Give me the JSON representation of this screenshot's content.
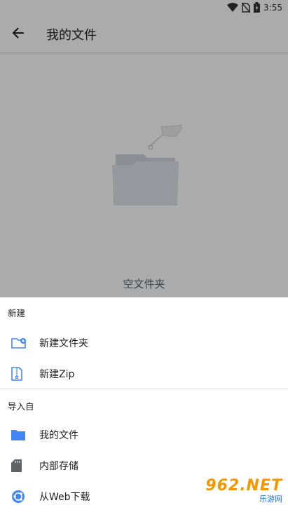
{
  "status_bar": {
    "time": "3:55"
  },
  "app_bar": {
    "title": "我的文件"
  },
  "empty_state": {
    "label": "空文件夹"
  },
  "sheet": {
    "new_section": {
      "header": "新建",
      "items": [
        {
          "label": "新建文件夹",
          "icon": "new-folder-icon"
        },
        {
          "label": "新建Zip",
          "icon": "zip-file-icon"
        }
      ]
    },
    "import_section": {
      "header": "导入自",
      "items": [
        {
          "label": "我的文件",
          "icon": "folder-icon"
        },
        {
          "label": "内部存储",
          "icon": "sd-card-icon"
        },
        {
          "label": "从Web下载",
          "icon": "web-globe-icon"
        }
      ]
    }
  },
  "watermark": {
    "big": "962.NET",
    "small": "乐游网"
  },
  "colors": {
    "accent": "#4285f4",
    "icon_gray": "#5f6368"
  }
}
